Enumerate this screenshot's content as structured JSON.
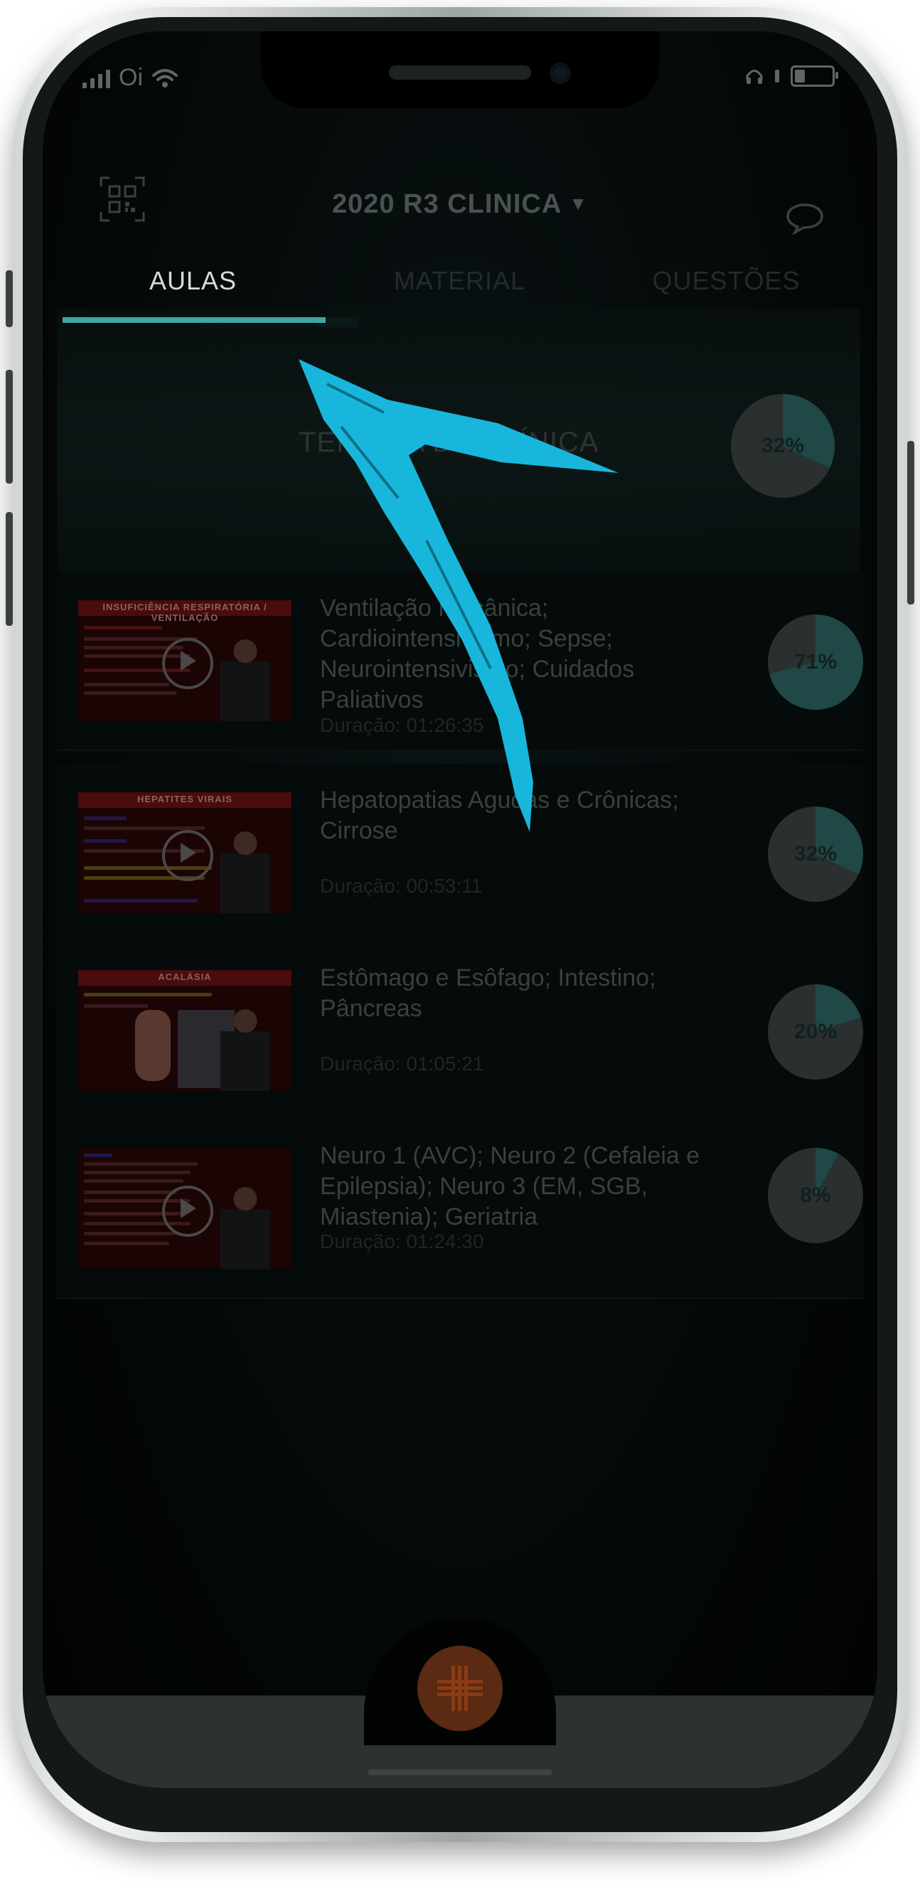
{
  "status_bar": {
    "carrier": "Oi"
  },
  "header": {
    "title": "2020 R3 CLINICA",
    "caret": "▼",
    "qr_icon": "qr-code-icon",
    "chat_icon": "chat-bubble-icon"
  },
  "tabs": [
    {
      "label": "AULAS",
      "active": true
    },
    {
      "label": "MATERIAL",
      "active": false
    },
    {
      "label": "QUESTÕES",
      "active": false
    }
  ],
  "course": {
    "title": "TERAPIA DE CLÍNICA",
    "progress": 32
  },
  "lessons": [
    {
      "title": "Ventilação Mecânica; Cardiointensivismo; Sepse; Neurointensivismo; Cuidados Paliativos",
      "duration": "Duração: 01:26:35",
      "progress": 71,
      "thumb_label": "INSUFICIÊNCIA RESPIRATÓRIA / VENTILAÇÃO"
    },
    {
      "title": "Hepatopatias Agudas e Crônicas; Cirrose",
      "duration": "Duração: 00:53:11",
      "progress": 32,
      "thumb_label": "HEPATITES VIRAIS"
    },
    {
      "title": "Estômago e Esôfago; Intestino; Pâncreas",
      "duration": "Duração: 01:05:21",
      "progress": 20,
      "thumb_label": "ACALÁSIA"
    },
    {
      "title": "Neuro 1 (AVC); Neuro 2 (Cefaleia e Epilepsia); Neuro 3 (EM, SGB, Miastenia); Geriatria",
      "duration": "Duração: 01:24:30",
      "progress": 8,
      "thumb_label": ""
    }
  ],
  "colors": {
    "accent": "#3ea6a6",
    "annotation_arrow": "#19b6dc",
    "home_button": "#8a3c14"
  }
}
